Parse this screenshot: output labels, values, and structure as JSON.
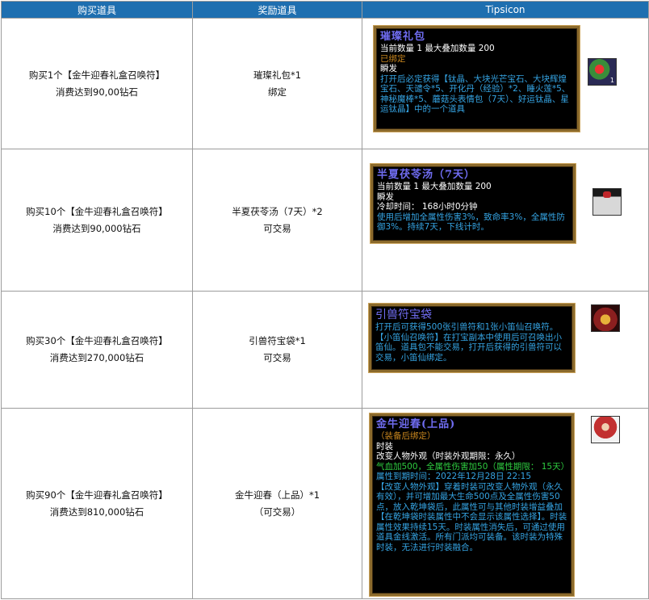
{
  "headers": [
    "购买道具",
    "奖励道具",
    "Tipsicon"
  ],
  "rows": [
    {
      "purchase": [
        "购买1个【金牛迎春礼盒召唤符】",
        "消费达到90,00钻石"
      ],
      "reward": [
        "璀璨礼包*1",
        "绑定"
      ],
      "tip": {
        "title": "璀璨礼包",
        "lines": [
          {
            "t": "当前数量 1 最大叠加数量 200",
            "c": "w"
          },
          {
            "t": "已绑定",
            "c": "o"
          },
          {
            "t": "瞬发",
            "c": "w"
          },
          {
            "t": "打开后必定获得【钛晶、大块光芒宝石、大块辉煌宝石、天谴令*5、开化丹（经验）*2、睡火莲*5、神秘魔棒*5、蘑菇头表情包（7天）、好运钛晶、星运钛晶】中的一个道具",
            "c": "b"
          }
        ],
        "icon": "gift-pack-icon"
      }
    },
    {
      "purchase": [
        "购买10个【金牛迎春礼盒召唤符】",
        "消费达到90,000钻石"
      ],
      "reward": [
        "半夏茯苓汤（7天）*2",
        "可交易"
      ],
      "tip": {
        "title": "半夏茯苓汤（7天）",
        "lines": [
          {
            "t": "当前数量 1 最大叠加数量 200",
            "c": "w"
          },
          {
            "t": "瞬发",
            "c": "w"
          },
          {
            "t": "冷却时间： 168小时0分钟",
            "c": "w"
          },
          {
            "t": "使用后增加全属性伤害3%，致命率3%，全属性防御3%。持续7天，下线计时。",
            "c": "b"
          }
        ],
        "icon": "soup-bowl-icon"
      }
    },
    {
      "purchase": [
        "购买30个【金牛迎春礼盒召唤符】",
        "消费达到270,000钻石"
      ],
      "reward": [
        "引兽符宝袋*1",
        "可交易"
      ],
      "tip": {
        "title": "引兽符宝袋",
        "lines": [
          {
            "t": "打开后可获得500张引兽符和1张小笛仙召唤符。【小笛仙召唤符】在打宝副本中使用后可召唤出小笛仙。道具包不能交易，打开后获得的引兽符可以交易，小笛仙绑定。",
            "c": "b"
          }
        ],
        "icon": "treasure-bag-icon"
      }
    },
    {
      "purchase": [
        "购买90个【金牛迎春礼盒召唤符】",
        "消费达到810,000钻石"
      ],
      "reward": [
        "金牛迎春（上品）*1",
        "（可交易）"
      ],
      "tip": {
        "title": "金牛迎春(上品)",
        "lines": [
          {
            "t": "（装备后绑定）",
            "c": "o"
          },
          {
            "t": "时装",
            "c": "w"
          },
          {
            "t": "改变人物外观（时装外观期限：永久）",
            "c": "w"
          },
          {
            "t": "气血加500，全属性伤害加50（属性期限： 15天）",
            "c": "g"
          },
          {
            "t": "属性到期时间：2022年12月28日 22:15",
            "c": "b"
          },
          {
            "t": "【改变人物外观】穿着时装可改变人物外观（永久有效），并可增加最大生命500点及全属性伤害50点，放入乾坤袋后，此属性可与其他时装增益叠加【在乾坤袋时装属性中不会显示该属性选择】。时装属性效果持续15天。时装属性消失后，可通过使用道具金线激活。所有门派均可装备。该时装为特殊时装，无法进行时装融合。",
            "c": "b"
          }
        ],
        "icon": "costume-icon"
      }
    }
  ],
  "colors": {
    "header_bg": "#1e6fb0",
    "tip_blue": "#35a4e3",
    "tip_title": "#6f6cf0",
    "tip_orange": "#c8861e",
    "tip_green": "#2ecc40",
    "tip_frame": "#8b6a2c"
  }
}
